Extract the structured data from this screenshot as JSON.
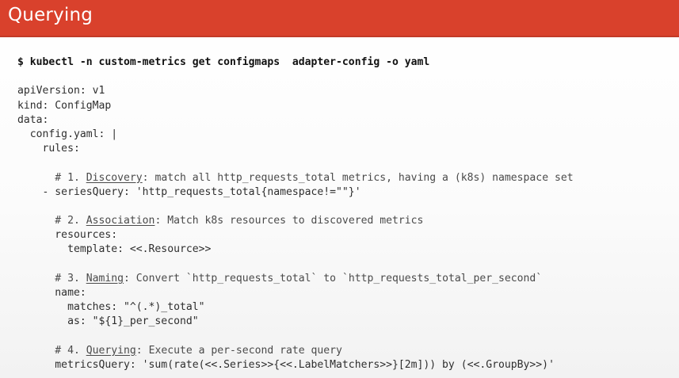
{
  "header": {
    "title": "Querying",
    "background_color": "#d9412c"
  },
  "code": {
    "command": "$ kubectl -n custom-metrics get configmaps  adapter-config -o yaml",
    "lines": [
      "apiVersion: v1",
      "kind: ConfigMap",
      "data:",
      "  config.yaml: |",
      "    rules:"
    ],
    "discovery": {
      "prefix": "      # 1. ",
      "keyword": "Discovery",
      "rest": ": match all http_requests_total metrics, having a (k8s) namespace set",
      "line": "    - seriesQuery: 'http_requests_total{namespace!=\"\"}'"
    },
    "association": {
      "prefix": "      # 2. ",
      "keyword": "Association",
      "rest": ": Match k8s resources to discovered metrics",
      "lines": [
        "      resources:",
        "        template: <<.Resource>>"
      ]
    },
    "naming": {
      "prefix": "      # 3. ",
      "keyword": "Naming",
      "rest": ": Convert `http_requests_total` to `http_requests_total_per_second`",
      "lines": [
        "      name:",
        "        matches: \"^(.*)_total\"",
        "        as: \"${1}_per_second\""
      ]
    },
    "querying": {
      "prefix": "      # 4. ",
      "keyword": "Querying",
      "rest": ": Execute a per-second rate query",
      "line": "      metricsQuery: 'sum(rate(<<.Series>>{<<.LabelMatchers>>}[2m])) by (<<.GroupBy>>)'"
    }
  }
}
